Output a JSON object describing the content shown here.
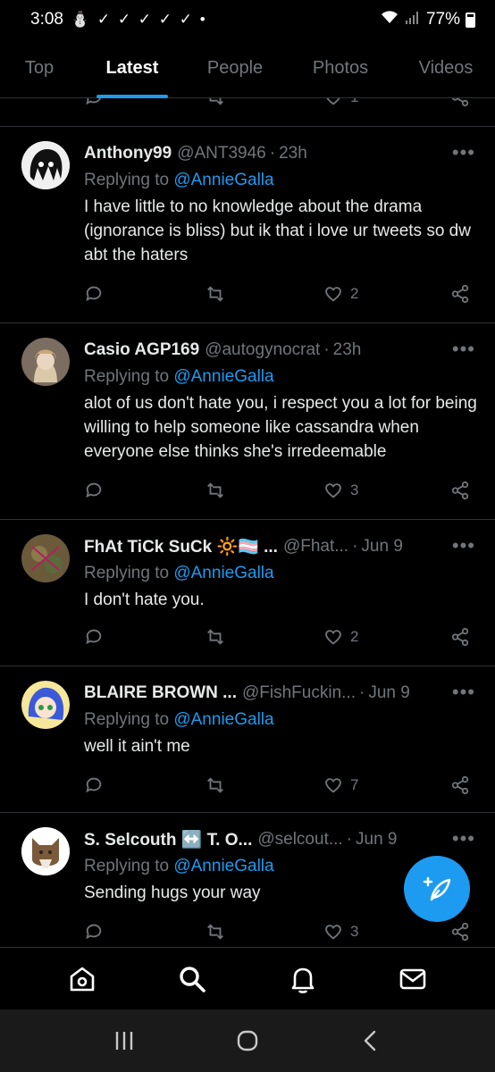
{
  "status": {
    "time": "3:08",
    "notif_icons": "⛄ ✓ ✓ ✓ ✓ ✓ •",
    "battery": "77%"
  },
  "tabs": [
    {
      "label": "Top",
      "active": false
    },
    {
      "label": "Latest",
      "active": true
    },
    {
      "label": "People",
      "active": false
    },
    {
      "label": "Photos",
      "active": false
    },
    {
      "label": "Videos",
      "active": false
    }
  ],
  "prev_tweet": {
    "likes": "1"
  },
  "tweets": [
    {
      "name": "Anthony99",
      "handle": "@ANT3946",
      "time": "23h",
      "replying_label": "Replying to",
      "replying_to": "@AnnieGalla",
      "text": "I have little to no knowledge about the drama (ignorance is bliss) but ik that i love ur tweets so dw abt the haters",
      "likes": "2",
      "avatar_color": "#e6e6e6"
    },
    {
      "name": "Casio AGP169",
      "handle": "@autogynocrat",
      "time": "23h",
      "replying_label": "Replying to",
      "replying_to": "@AnnieGalla",
      "text": "alot of us don't hate you, i respect you a lot for being willing to help someone like cassandra when everyone else thinks she's irredeemable",
      "likes": "3",
      "avatar_color": "#8a7a6a"
    },
    {
      "name": "FhAt TiCk SuCk 🔆🏳️‍⚧️ ...",
      "handle": "@Fhat...",
      "time": "Jun 9",
      "replying_label": "Replying to",
      "replying_to": "@AnnieGalla",
      "text": "I don't hate you.",
      "likes": "2",
      "avatar_color": "#6a5a3a"
    },
    {
      "name": "BLAIRE BROWN ...",
      "handle": "@FishFuckin...",
      "time": "Jun 9",
      "replying_label": "Replying to",
      "replying_to": "@AnnieGalla",
      "text": "well it ain't me",
      "likes": "7",
      "avatar_color": "#f4e08a"
    },
    {
      "name": "S. Selcouth ↔️ T. O...",
      "handle": "@selcout...",
      "time": "Jun 9",
      "replying_label": "Replying to",
      "replying_to": "@AnnieGalla",
      "text": "Sending hugs your way",
      "likes": "3",
      "avatar_color": "#ffffff"
    }
  ],
  "icons": {
    "reply": "reply-icon",
    "retweet": "retweet-icon",
    "like": "heart-icon",
    "share": "share-icon",
    "more": "more-icon",
    "compose": "compose-icon",
    "home": "home-icon",
    "search": "search-icon",
    "notifications": "bell-icon",
    "messages": "mail-icon"
  },
  "colors": {
    "accent": "#1d9bf0",
    "muted": "#71767b",
    "background": "#000000"
  }
}
